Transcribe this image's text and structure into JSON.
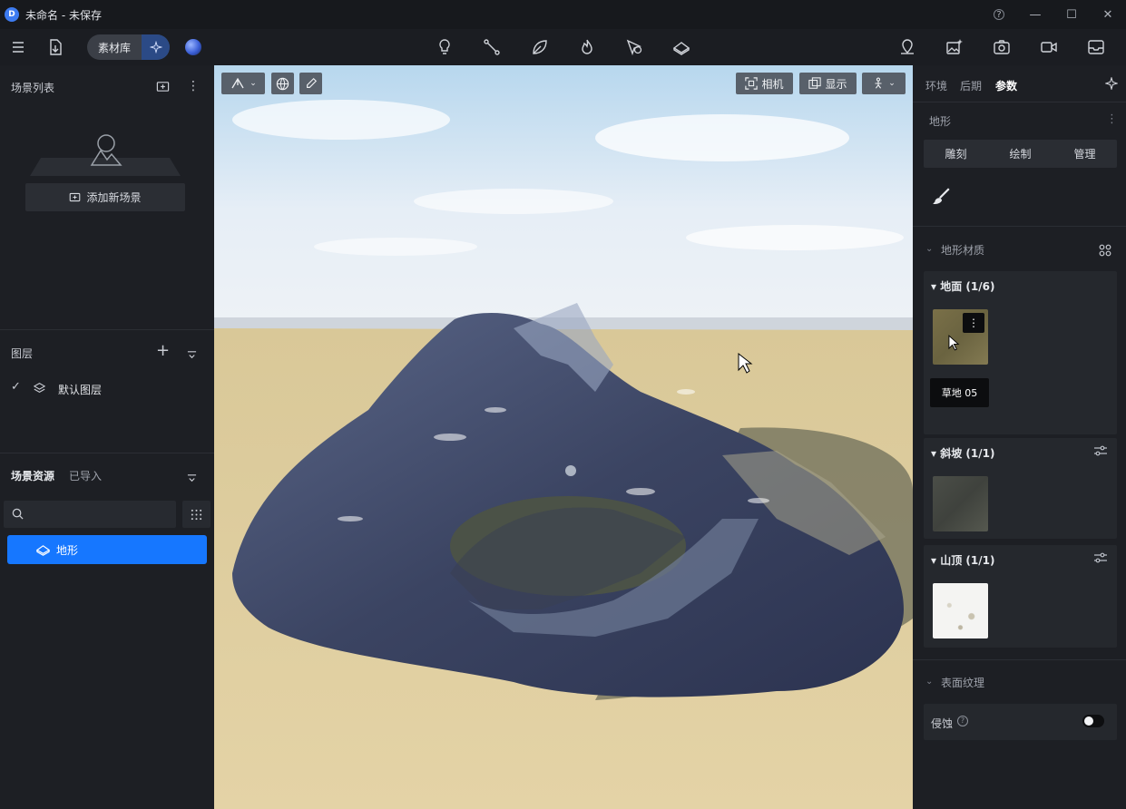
{
  "titlebar": {
    "title": "未命名 - 未保存",
    "logo_letter": "D",
    "help": "?",
    "minimize": "—",
    "maximize": "☐",
    "close": "✕"
  },
  "toolbar": {
    "material_library_label": "素材库",
    "ai_icon": "sparkle-icon",
    "center_icons": [
      "bulb-icon",
      "path-icon",
      "leaf-icon",
      "flame-icon",
      "pointer-plus-icon",
      "terrain-layer-icon"
    ],
    "right_icons": [
      "location-pin-icon",
      "image-sparkle-icon",
      "camera-icon",
      "video-icon",
      "inbox-icon"
    ]
  },
  "left": {
    "scene_list_title": "场景列表",
    "add_scene_label": "添加新场景",
    "layers_title": "图层",
    "default_layer": "默认图层",
    "assets_tab": "场景资源",
    "imported_tab": "已导入",
    "search_placeholder": "",
    "terrain_item": "地形"
  },
  "viewport": {
    "camera_label": "相机",
    "display_label": "显示"
  },
  "right": {
    "tabs": [
      "环境",
      "后期",
      "参数"
    ],
    "active_tab": "参数",
    "terrain_title": "地形",
    "subtabs": [
      "雕刻",
      "绘制",
      "管理"
    ],
    "terrain_material_title": "地形材质",
    "ground": {
      "title": "地面 (1/6)",
      "tooltip": "草地 05"
    },
    "slope": {
      "title": "斜坡 (1/1)"
    },
    "peak": {
      "title": "山顶 (1/1)"
    },
    "surface_texture_title": "表面纹理",
    "erosion_label": "侵蚀",
    "erosion_enabled": false
  },
  "colors": {
    "accent": "#1677ff",
    "panel": "#1d1f24",
    "card": "#25282d"
  }
}
